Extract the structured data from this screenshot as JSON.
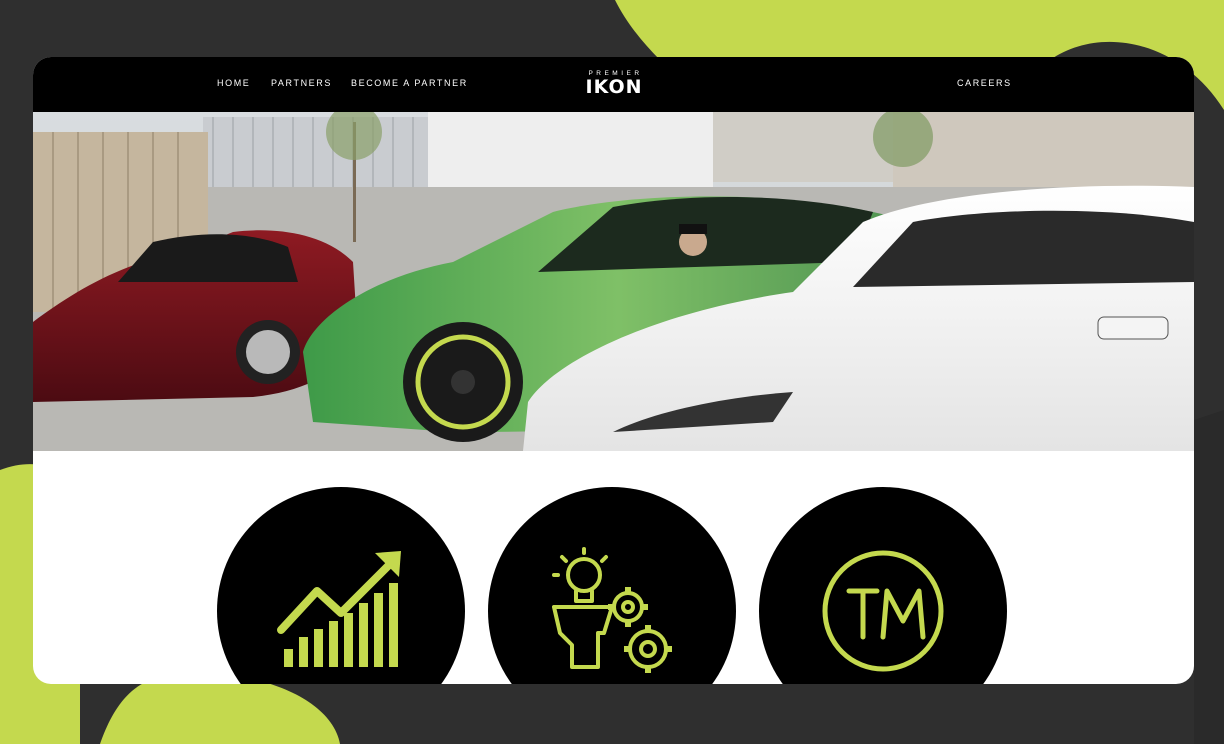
{
  "nav": {
    "links": [
      {
        "label": "HOME"
      },
      {
        "label": "PARTNERS"
      },
      {
        "label": "BECOME A PARTNER"
      },
      {
        "label": "CAREERS"
      }
    ],
    "logo": {
      "top": "PREMIER",
      "main": "IKON"
    }
  },
  "hero": {
    "image": "car-meet-photo",
    "description_icons": [
      "red-coupe",
      "green-sports-car",
      "white-sports-car"
    ]
  },
  "features": {
    "icons": [
      "growth-chart-icon",
      "idea-gears-icon",
      "trademark-icon"
    ]
  },
  "colors": {
    "accent": "#c4d94e",
    "background": "#2f2f2f",
    "navbar": "#000000",
    "card": "#ffffff"
  }
}
